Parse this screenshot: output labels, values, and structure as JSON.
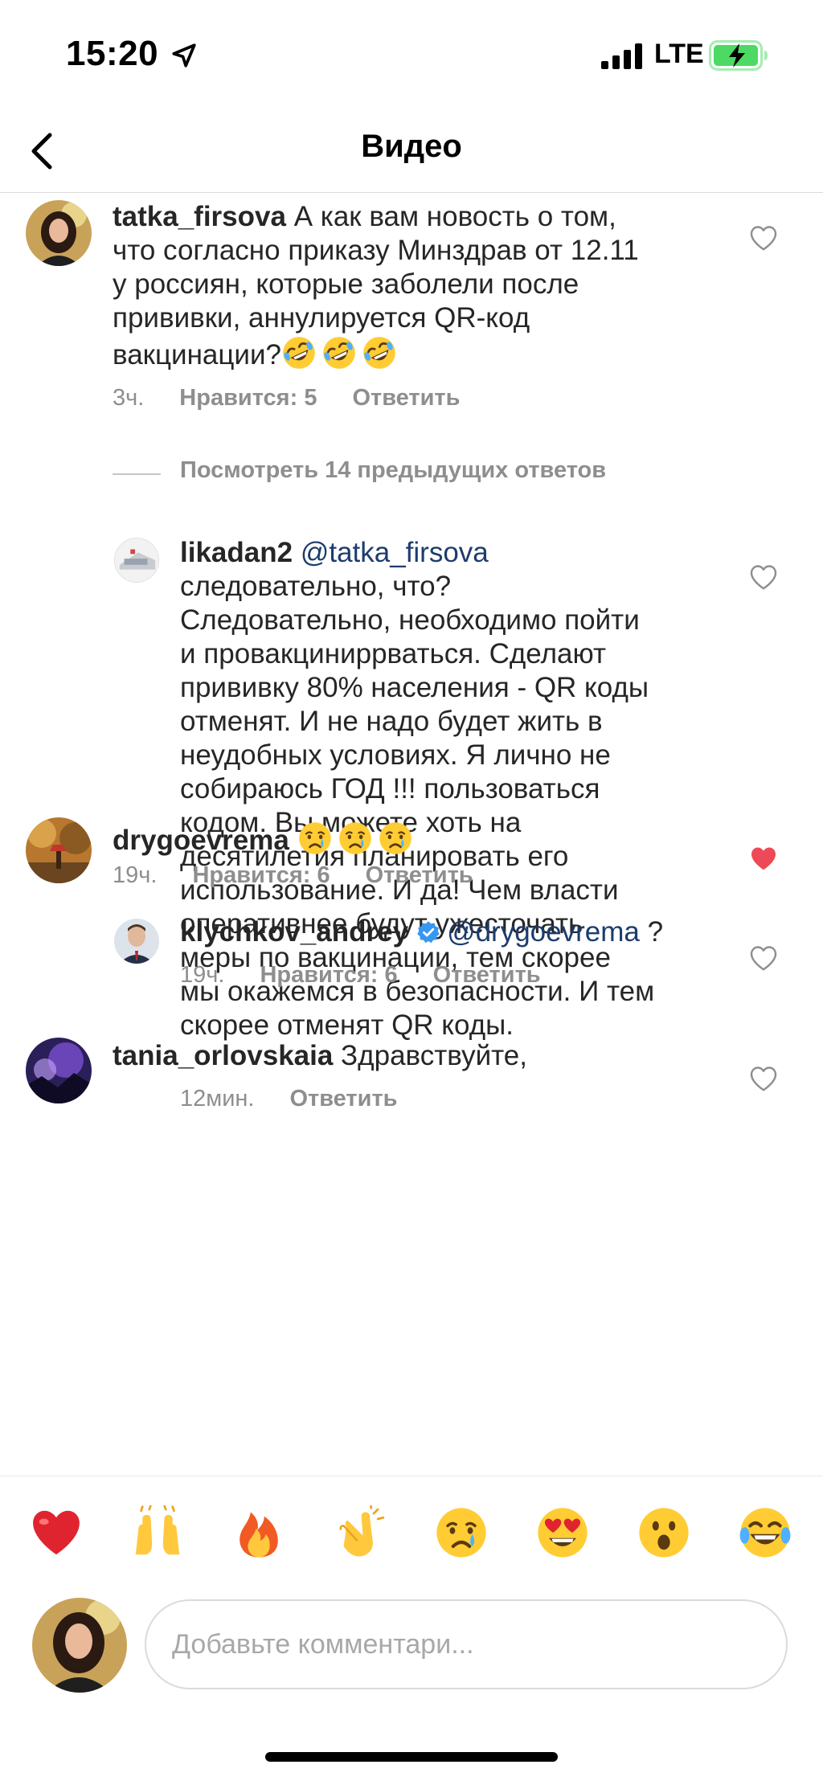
{
  "status_bar": {
    "time": "15:20",
    "network": "LTE",
    "icons": [
      "location-arrow-icon",
      "signal-icon",
      "battery-charging-icon"
    ]
  },
  "nav": {
    "title": "Видео",
    "back_icon": "chevron-left-icon"
  },
  "comments": [
    {
      "username": "tatka_firsova",
      "text": "А как вам новость о том, что согласно приказу Минздрав от 12.11 у россиян, которые заболели после прививки, аннулируется QR-код вакцинации?",
      "lines": [
        "А как вам новость о том,",
        "что согласно приказу Минздрав от 12.11",
        "у россиян, которые заболели после",
        "прививки, аннулируется QR-код",
        "вакцинации?"
      ],
      "emojis": [
        "rofl-emoji",
        "rofl-emoji",
        "rofl-emoji"
      ],
      "time": "3ч.",
      "likes": "Нравится: 5",
      "reply": "Ответить",
      "liked": false
    },
    {
      "username": "likadan2",
      "mention": "@tatka_firsova",
      "lines": [
        "следовательно, что?",
        "Следовательно, необходимо пойти",
        "и провакциниррваться. Сделают",
        "прививку 80% населения - QR коды",
        "отменят. И не надо будет жить в",
        "неудобных условиях. Я лично не",
        "собираюсь ГОД !!! пользоваться",
        "кодом. Вы можете хоть на",
        "десятилетия планировать его",
        "использование. И да! Чем власти",
        "оперативнее будут ужесточать",
        "меры по вакцинации, тем скорее",
        "мы окажемся в безопасности. И тем",
        "скорее отменят QR коды."
      ],
      "time": "12мин.",
      "reply": "Ответить",
      "liked": false
    },
    {
      "username": "drygoevrema",
      "emojis": [
        "crying-face-emoji",
        "crying-face-emoji",
        "crying-face-emoji"
      ],
      "time": "19ч.",
      "likes": "Нравится: 6",
      "reply": "Ответить",
      "liked": true
    },
    {
      "username": "klychkov_andrey",
      "verified": true,
      "mention": "@drygoevrema",
      "text": "?",
      "time": "19ч.",
      "likes": "Нравится: 6",
      "reply": "Ответить",
      "liked": false
    },
    {
      "username": "tania_orlovskaia",
      "text": "Здравствуйте,",
      "liked": false
    }
  ],
  "view_more_replies": "Посмотреть 14 предыдущих ответов",
  "reactions": [
    "red-heart-emoji",
    "raising-hands-emoji",
    "fire-emoji",
    "clapping-hands-emoji",
    "crying-face-emoji",
    "heart-eyes-emoji",
    "surprised-face-emoji",
    "tears-of-joy-emoji"
  ],
  "composer": {
    "placeholder": "Добавьте комментари..."
  },
  "colors": {
    "text": "#262626",
    "secondary": "#8e8e8e",
    "mention": "#1d3c6e",
    "liked_heart": "#ed4956",
    "battery_green": "#4cd964"
  }
}
